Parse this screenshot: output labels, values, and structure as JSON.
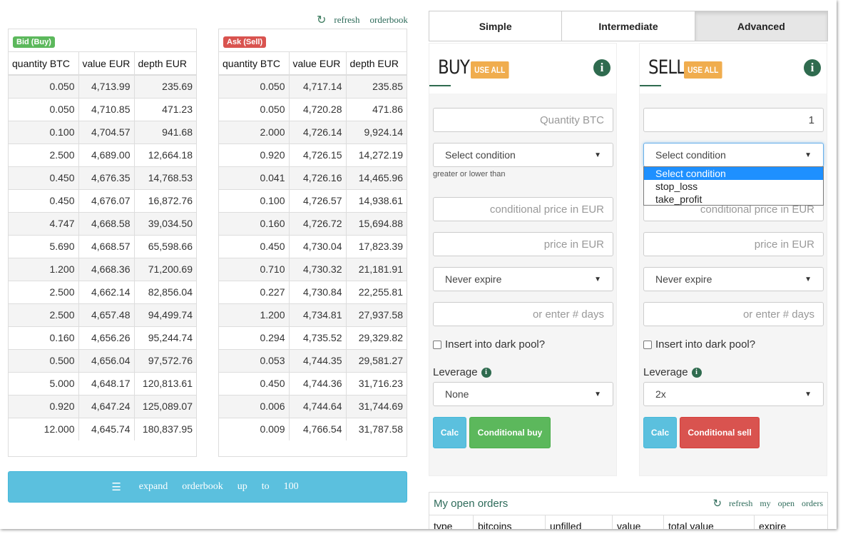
{
  "orderbook_links": {
    "refresh": "refresh",
    "orderbook": "orderbook"
  },
  "bid": {
    "badge": "Bid (Buy)",
    "columns": [
      "quantity BTC",
      "value EUR",
      "depth EUR"
    ],
    "rows": [
      [
        "0.050",
        "4,713.99",
        "235.69"
      ],
      [
        "0.050",
        "4,710.85",
        "471.23"
      ],
      [
        "0.100",
        "4,704.57",
        "941.68"
      ],
      [
        "2.500",
        "4,689.00",
        "12,664.18"
      ],
      [
        "0.450",
        "4,676.35",
        "14,768.53"
      ],
      [
        "0.450",
        "4,676.07",
        "16,872.76"
      ],
      [
        "4.747",
        "4,668.58",
        "39,034.50"
      ],
      [
        "5.690",
        "4,668.57",
        "65,598.66"
      ],
      [
        "1.200",
        "4,668.36",
        "71,200.69"
      ],
      [
        "2.500",
        "4,662.14",
        "82,856.04"
      ],
      [
        "2.500",
        "4,657.48",
        "94,499.74"
      ],
      [
        "0.160",
        "4,656.26",
        "95,244.74"
      ],
      [
        "0.500",
        "4,656.04",
        "97,572.76"
      ],
      [
        "5.000",
        "4,648.17",
        "120,813.61"
      ],
      [
        "0.920",
        "4,647.24",
        "125,089.07"
      ],
      [
        "12.000",
        "4,645.74",
        "180,837.95"
      ]
    ]
  },
  "ask": {
    "badge": "Ask (Sell)",
    "columns": [
      "quantity BTC",
      "value EUR",
      "depth EUR"
    ],
    "rows": [
      [
        "0.050",
        "4,717.14",
        "235.85"
      ],
      [
        "0.050",
        "4,720.28",
        "471.86"
      ],
      [
        "2.000",
        "4,726.14",
        "9,924.14"
      ],
      [
        "0.920",
        "4,726.15",
        "14,272.19"
      ],
      [
        "0.041",
        "4,726.16",
        "14,465.96"
      ],
      [
        "0.100",
        "4,726.57",
        "14,938.61"
      ],
      [
        "0.160",
        "4,726.72",
        "15,694.88"
      ],
      [
        "0.450",
        "4,730.04",
        "17,823.39"
      ],
      [
        "0.710",
        "4,730.32",
        "21,181.91"
      ],
      [
        "0.227",
        "4,730.84",
        "22,255.81"
      ],
      [
        "1.200",
        "4,734.81",
        "27,937.58"
      ],
      [
        "0.294",
        "4,735.52",
        "29,329.82"
      ],
      [
        "0.053",
        "4,744.35",
        "29,581.27"
      ],
      [
        "0.450",
        "4,744.36",
        "31,716.23"
      ],
      [
        "0.006",
        "4,744.64",
        "31,744.69"
      ],
      [
        "0.009",
        "4,766.54",
        "31,787.58"
      ]
    ]
  },
  "expand_button": {
    "words": [
      "expand",
      "orderbook",
      "up",
      "to",
      "100"
    ]
  },
  "tabs": [
    {
      "label": "Simple",
      "active": false
    },
    {
      "label": "Intermediate",
      "active": false
    },
    {
      "label": "Advanced",
      "active": true
    }
  ],
  "buy": {
    "title": "BUY",
    "use_all": "USE ALL",
    "quantity_placeholder": "Quantity BTC",
    "quantity_value": "",
    "condition_select": "Select condition",
    "condition_hint": "greater or lower than",
    "cond_price_placeholder": "conditional price in EUR",
    "price_placeholder": "price in EUR",
    "expire_select": "Never expire",
    "days_placeholder": "or enter # days",
    "dark_pool": "Insert into dark pool?",
    "leverage_label": "Leverage",
    "leverage_value": "None",
    "calc": "Calc",
    "submit": "Conditional buy"
  },
  "sell": {
    "title": "SELL",
    "use_all": "USE ALL",
    "quantity_value": "1",
    "condition_select": "Select condition",
    "condition_options": [
      "Select condition",
      "stop_loss",
      "take_profit"
    ],
    "cond_price_placeholder": "conditional price in EUR",
    "price_placeholder": "price in EUR",
    "expire_select": "Never expire",
    "days_placeholder": "or enter # days",
    "dark_pool": "Insert into dark pool?",
    "leverage_label": "Leverage",
    "leverage_value": "2x",
    "calc": "Calc",
    "submit": "Conditional sell"
  },
  "open_orders": {
    "title": "My open orders",
    "refresh_words": [
      "refresh",
      "my",
      "open",
      "orders"
    ],
    "columns": [
      "type",
      "bitcoins",
      "unfilled",
      "value",
      "total value",
      "expire"
    ]
  },
  "colors": {
    "info_green": "#2f6b4f",
    "use_all_orange": "#f0ad4e",
    "calc_blue": "#5bc0de",
    "buy_green": "#5cb85c",
    "sell_red": "#d9534f"
  }
}
